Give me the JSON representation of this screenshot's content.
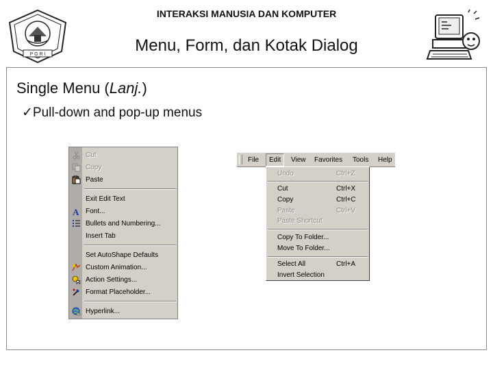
{
  "header": {
    "title": "INTERAKSI MANUSIA DAN KOMPUTER",
    "subtitle": "Menu, Form, dan Kotak Dialog",
    "logo_text": "P G R I"
  },
  "slide": {
    "heading_main": "Single Menu (",
    "heading_italic": "Lanj.",
    "heading_end": ")",
    "bullet_mark": "ü",
    "bullet_text": "Pull-down and pop-up menus"
  },
  "context_menu": {
    "items": [
      {
        "label": "Cut",
        "icon": "scissors-icon",
        "disabled": true
      },
      {
        "label": "Copy",
        "icon": "copy-icon",
        "disabled": true
      },
      {
        "label": "Paste",
        "icon": "paste-icon",
        "disabled": false
      },
      {
        "label": "Exit Edit Text",
        "icon": "",
        "disabled": false
      },
      {
        "label": "Font...",
        "icon": "font-icon",
        "disabled": false
      },
      {
        "label": "Bullets and Numbering...",
        "icon": "bullets-icon",
        "disabled": false
      },
      {
        "label": "Insert Tab",
        "icon": "",
        "disabled": false
      },
      {
        "label": "Set AutoShape Defaults",
        "icon": "",
        "disabled": false
      },
      {
        "label": "Custom Animation...",
        "icon": "animation-icon",
        "disabled": false
      },
      {
        "label": "Action Settings...",
        "icon": "action-icon",
        "disabled": false
      },
      {
        "label": "Format Placeholder...",
        "icon": "format-icon",
        "disabled": false
      },
      {
        "label": "Hyperlink...",
        "icon": "hyperlink-icon",
        "disabled": false
      }
    ]
  },
  "menubar": {
    "items": [
      "File",
      "Edit",
      "View",
      "Favorites",
      "Tools",
      "Help"
    ],
    "active": "Edit"
  },
  "edit_menu": {
    "items": [
      {
        "label": "Undo",
        "shortcut": "Ctrl+Z",
        "disabled": true
      },
      {
        "label": "Cut",
        "shortcut": "Ctrl+X",
        "disabled": false
      },
      {
        "label": "Copy",
        "shortcut": "Ctrl+C",
        "disabled": false
      },
      {
        "label": "Paste",
        "shortcut": "Ctrl+V",
        "disabled": true
      },
      {
        "label": "Paste Shortcut",
        "shortcut": "",
        "disabled": true
      },
      {
        "label": "Copy To Folder...",
        "shortcut": "",
        "disabled": false
      },
      {
        "label": "Move To Folder...",
        "shortcut": "",
        "disabled": false
      },
      {
        "label": "Select All",
        "shortcut": "Ctrl+A",
        "disabled": false
      },
      {
        "label": "Invert Selection",
        "shortcut": "",
        "disabled": false
      }
    ]
  }
}
